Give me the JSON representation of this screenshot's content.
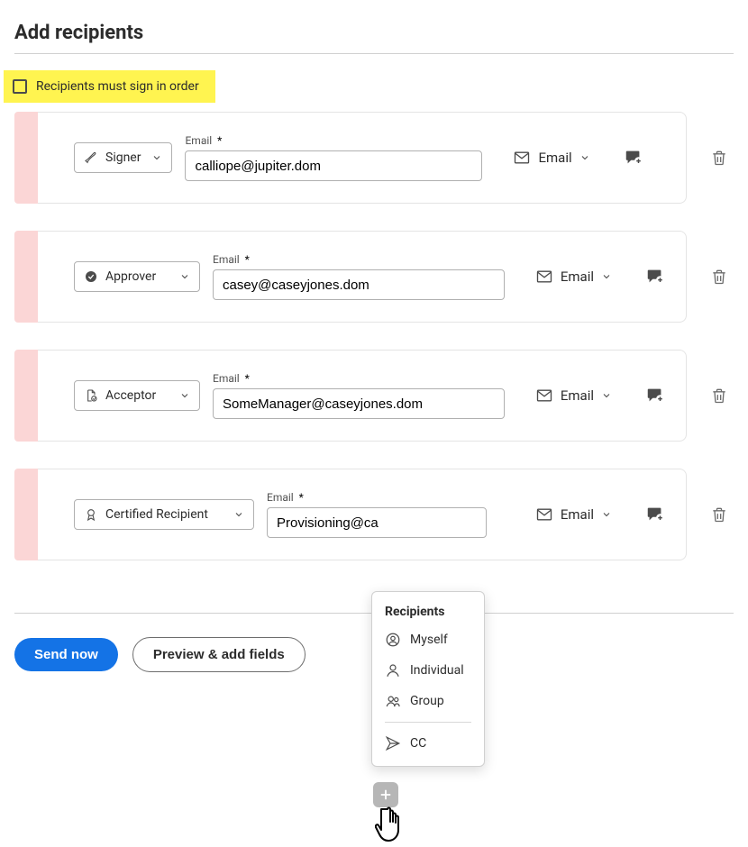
{
  "title": "Add recipients",
  "sign_in_order_label": "Recipients must sign in order",
  "sign_in_order_checked": false,
  "email_field_label": "Email",
  "email_required_marker": "*",
  "recipients": [
    {
      "role": "Signer",
      "email": "calliope@jupiter.dom",
      "delivery": "Email"
    },
    {
      "role": "Approver",
      "email": "casey@caseyjones.dom",
      "delivery": "Email"
    },
    {
      "role": "Acceptor",
      "email": "SomeManager@caseyjones.dom",
      "delivery": "Email"
    },
    {
      "role": "Certified Recipient",
      "email": "Provisioning@ca",
      "delivery": "Email"
    }
  ],
  "popup": {
    "title": "Recipients",
    "items": [
      "Myself",
      "Individual",
      "Group"
    ],
    "cc_label": "CC"
  },
  "buttons": {
    "send": "Send now",
    "preview": "Preview & add fields"
  }
}
